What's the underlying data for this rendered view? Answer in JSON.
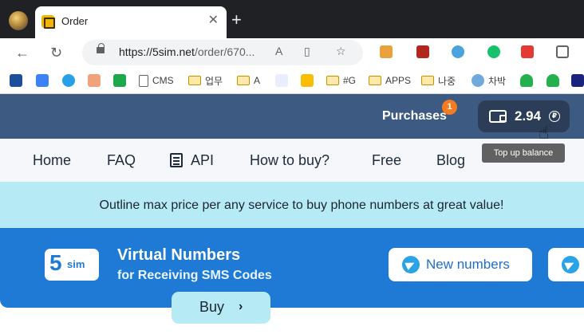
{
  "browser": {
    "tab_title": "Order",
    "tab_close": "✕",
    "new_tab": "+",
    "url_host": "https://5sim.net",
    "url_path": "/order/670...",
    "bookmarks": [
      "CMS",
      "업무",
      "A",
      "#G",
      "APPS",
      "나중",
      "차박"
    ]
  },
  "header": {
    "purchases_label": "Purchases",
    "purchases_count": "1",
    "balance": "2.94",
    "currency_symbol": "₽",
    "tooltip": "Top up balance"
  },
  "nav": {
    "items": [
      "Home",
      "FAQ",
      "API",
      "How to buy?",
      "Free",
      "Blog"
    ]
  },
  "promo": {
    "text": "Outline max price per any service to buy phone numbers at great value!"
  },
  "hero": {
    "logo_digit": "5",
    "logo_text": "sim",
    "title": "Virtual Numbers",
    "subtitle": "for Receiving SMS Codes",
    "new_numbers_label": "New numbers"
  },
  "buy": {
    "label": "Buy",
    "chevron": "›"
  },
  "colors": {
    "header_bg": "#3d5a82",
    "hero_bg": "#1f7ad6",
    "promo_bg": "#b6ebf6",
    "badge": "#f47b20"
  }
}
